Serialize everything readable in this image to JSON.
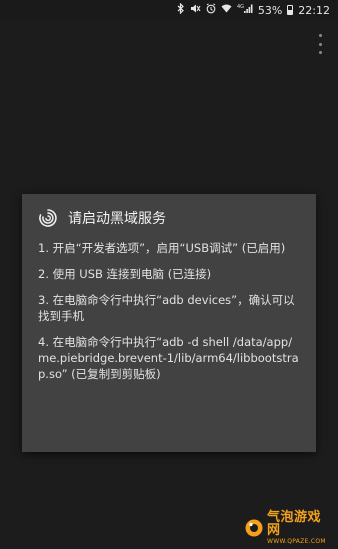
{
  "status_bar": {
    "battery_percent": "53%",
    "time": "22:12",
    "network": "4G",
    "icons": [
      "bluetooth-icon",
      "mute-icon",
      "alarm-icon",
      "wifi-icon",
      "signal-icon",
      "battery-icon"
    ]
  },
  "app_bar": {
    "menu_icon": "overflow-menu-icon"
  },
  "dialog": {
    "title": "请启动黑域服务",
    "icon": "brevent-swirl-icon",
    "steps": [
      "1. 开启“开发者选项”，启用“USB调试” (已启用)",
      "2. 使用 USB 连接到电脑 (已连接)",
      "3. 在电脑命令行中执行“adb devices”，确认可以找到手机",
      "4. 在电脑命令行中执行“adb -d shell /data/app/me.piebridge.brevent-1/lib/arm64/libbootstrap.so” (已复制到剪贴板)"
    ]
  },
  "watermark": {
    "name": "气泡游戏网",
    "url": "WWW.QPAZE.COM"
  },
  "colors": {
    "background": "#1c1c1c",
    "dialog": "#424242",
    "watermark": "#f4a21c"
  }
}
